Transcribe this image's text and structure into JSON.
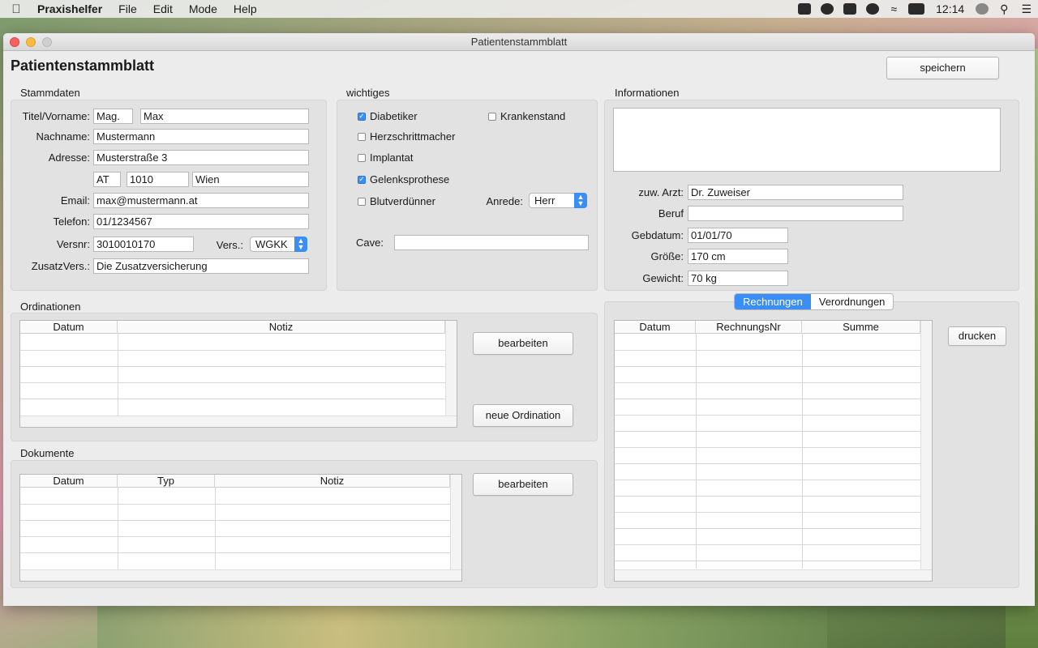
{
  "menubar": {
    "app_name": "Praxishelfer",
    "items": [
      "File",
      "Edit",
      "Mode",
      "Help"
    ],
    "clock": "12:14"
  },
  "window": {
    "title": "Patientenstammblatt",
    "page_title": "Patientenstammblatt",
    "save_label": "speichern"
  },
  "stammdaten": {
    "label": "Stammdaten",
    "titel_vorname_label": "Titel/Vorname:",
    "titel": "Mag.",
    "vorname": "Max",
    "nachname_label": "Nachname:",
    "nachname": "Mustermann",
    "adresse_label": "Adresse:",
    "adresse": "Musterstraße 3",
    "land": "AT",
    "plz": "1010",
    "ort": "Wien",
    "email_label": "Email:",
    "email": "max@mustermann.at",
    "telefon_label": "Telefon:",
    "telefon": "01/1234567",
    "versnr_label": "Versnr:",
    "versnr": "3010010170",
    "vers_label": "Vers.:",
    "vers": "WGKK",
    "zusatzvers_label": "ZusatzVers.:",
    "zusatzvers": "Die Zusatzversicherung"
  },
  "wichtiges": {
    "label": "wichtiges",
    "diabetiker": "Diabetiker",
    "krankenstand": "Krankenstand",
    "herzschrittmacher": "Herzschrittmacher",
    "implantat": "Implantat",
    "gelenksprothese": "Gelenksprothese",
    "blutverduenner": "Blutverdünner",
    "anrede_label": "Anrede:",
    "anrede": "Herr",
    "cave_label": "Cave:",
    "cave": ""
  },
  "informationen": {
    "label": "Informationen",
    "text": "",
    "zuw_arzt_label": "zuw. Arzt:",
    "zuw_arzt": "Dr. Zuweiser",
    "beruf_label": "Beruf",
    "beruf": "",
    "gebdatum_label": "Gebdatum:",
    "gebdatum": "01/01/70",
    "groesse_label": "Größe:",
    "groesse": "170 cm",
    "gewicht_label": "Gewicht:",
    "gewicht": "70 kg"
  },
  "ordinationen": {
    "label": "Ordinationen",
    "columns": [
      "Datum",
      "Notiz"
    ],
    "edit_label": "bearbeiten",
    "new_label": "neue Ordination"
  },
  "dokumente": {
    "label": "Dokumente",
    "columns": [
      "Datum",
      "Typ",
      "Notiz"
    ],
    "edit_label": "bearbeiten"
  },
  "rechnungen": {
    "tabs": [
      "Rechnungen",
      "Verordnungen"
    ],
    "columns": [
      "Datum",
      "RechnungsNr",
      "Summe"
    ],
    "print_label": "drucken"
  }
}
